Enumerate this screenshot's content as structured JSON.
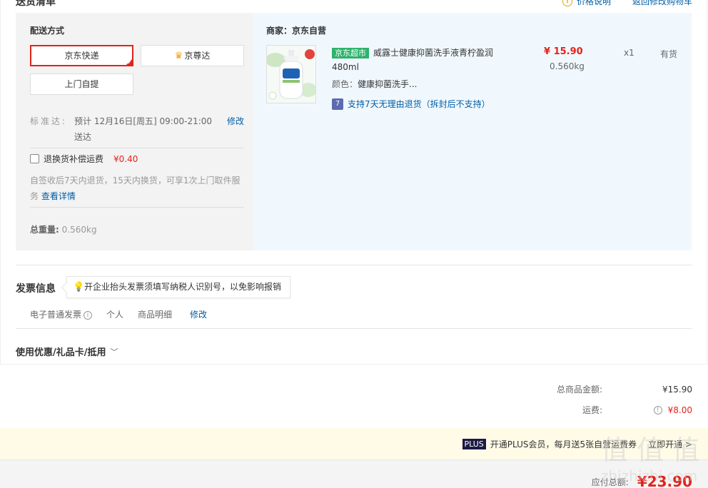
{
  "header": {
    "title": "送货清单",
    "links": [
      {
        "label": "价格说明",
        "icon": "info-icon"
      },
      {
        "label": "返回修改购物车"
      }
    ]
  },
  "shipping": {
    "title": "配送方式",
    "options": [
      {
        "label": "京东快递",
        "selected": true
      },
      {
        "label": "京尊达",
        "icon": "crown-icon"
      },
      {
        "label": "上门自提"
      }
    ],
    "standard_label": "标准达:",
    "standard_value": "预计 12月16日[周五] 09:00-21:00 送达",
    "standard_edit": "修改",
    "return_option_label": "退换货补偿运费",
    "return_option_price": "¥0.40",
    "return_desc": "自签收后7天内退货，15天内换货，可享1次上门取件服务",
    "return_link": "查看详情",
    "weight_label": "总重量:",
    "weight_value": "0.560kg"
  },
  "product": {
    "merchant_label": "商家：京东自营",
    "tag": "京东超市",
    "name": "威露士健康抑菌洗手液青柠盈润480ml",
    "color_label": "颜色：",
    "color_value": "健康抑菌洗手...",
    "return_policy": "支持7天无理由退货（拆封后不支持）",
    "price": "¥ 15.90",
    "weight": "0.560kg",
    "qty": "x1",
    "stock": "有货"
  },
  "invoice": {
    "title": "发票信息",
    "tip": "开企业抬头发票须填写纳税人识别号，以免影响报销",
    "type": "电子普通发票",
    "person": "个人",
    "detail": "商品明细",
    "edit": "修改"
  },
  "coupon": {
    "label": "使用优惠/礼品卡/抵用"
  },
  "totals": {
    "goods_label": "总商品金额:",
    "goods_value": "¥15.90",
    "shipping_label": "运费:",
    "shipping_value": "¥8.00"
  },
  "plus": {
    "badge": "PLUS",
    "text": "开通PLUS会员，每月送5张自营运费券",
    "link": "立即开通 >"
  },
  "payable": {
    "label": "应付总额:",
    "value": "¥23.90"
  },
  "watermark": {
    "text": "值 值 值",
    "url": "zhizhizhi.com"
  },
  "colors": {
    "accent_red": "#e2231a",
    "link_blue": "#005ea7",
    "jd_green": "#2db36b",
    "product_bg": "#f1f8fd"
  }
}
